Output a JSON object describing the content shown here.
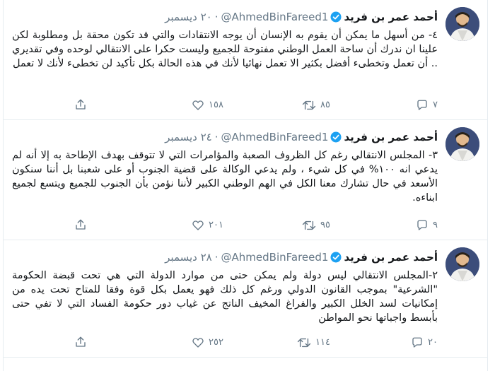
{
  "tweets": [
    {
      "name": "أحمد عمر بن فريد",
      "handle": "@AhmedBinFareed1",
      "time": "٢٠ ديسمبر",
      "text": "٤- من أسهل ما يمكن أن يقوم به الإنسان أن يوجه الانتقادات والتي قد تكون محقة بل ومطلوبة لكن علينا ان ندرك أن ساحة العمل الوطني مفتوحة للجميع وليست حكرا على الانتقالي لوحده وفي تقديري .. أن تعمل وتخطىء أفضل بكثير الا تعمل نهائيا لأنك في هذه الحالة بكل تأكيد لن تخطىء لأنك لا تعمل",
      "replies": "٧",
      "retweets": "٨٥",
      "likes": "١٥٨"
    },
    {
      "name": "أحمد عمر بن فريد",
      "handle": "@AhmedBinFareed1",
      "time": "٢٤ ديسمبر",
      "text": "٣- المجلس الانتقالي رغم كل الظروف الصعبة والمؤامرات التي لا تتوقف بهدف الإطاحة به إلا أنه لم يدعي انه ١٠٠% في كل شيء ، ولم يدعي الوكالة على قضية الجنوب أو على شعبنا بل أننا سنكون الأسعد في حال تشارك معنا الكل في الهم الوطني الكبير لأننا نؤمن بأن الجنوب للجميع ويتسع لجميع ابناءه.",
      "replies": "٩",
      "retweets": "٩٥",
      "likes": "٢٠١"
    },
    {
      "name": "أحمد عمر بن فريد",
      "handle": "@AhmedBinFareed1",
      "time": "٢٨ ديسمبر",
      "text": "٢-المجلس الانتقالي ليس دولة ولم يمكن حتى من موارد الدولة التي هي تحت قبضة الحكومة \"الشرعية\" بموجب القانون الدولي ورغم كل ذلك فهو يعمل بكل قوة وفقا للمتاح تحت يده من إمكانيات لسد الخلل الكبير والفراغ المخيف الناتج عن غياب دور حكومة الفساد التي لا تفي حتى بأبسط واجباتها نحو المواطن",
      "replies": "٢٠",
      "retweets": "١١٤",
      "likes": "٢٥٢"
    }
  ],
  "icons": {
    "avatar": "profile-photo",
    "verified": "verified-badge-icon",
    "more": "chevron-down-icon",
    "reply": "reply-icon",
    "retweet": "retweet-icon",
    "like": "heart-icon",
    "share": "share-icon"
  },
  "colors": {
    "text": "#14171a",
    "muted": "#657786",
    "verified": "#1da1f2",
    "border": "#e6ecf0"
  }
}
